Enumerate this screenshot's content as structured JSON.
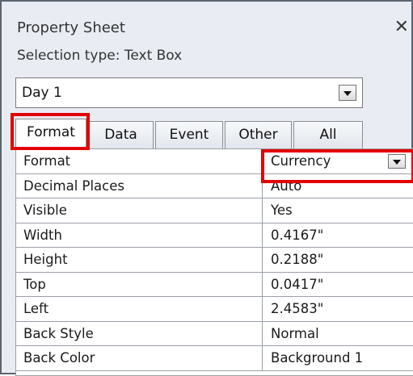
{
  "panel": {
    "title": "Property Sheet",
    "close_glyph": "✕",
    "selection_type": "Selection type:  Text Box"
  },
  "object_combo": {
    "value": "Day 1"
  },
  "tabs": [
    {
      "label": "Format",
      "active": true
    },
    {
      "label": "Data",
      "active": false
    },
    {
      "label": "Event",
      "active": false
    },
    {
      "label": "Other",
      "active": false
    },
    {
      "label": "All",
      "active": false
    }
  ],
  "properties": [
    {
      "name": "Format",
      "value": "Currency",
      "has_dropdown": true
    },
    {
      "name": "Decimal Places",
      "value": "Auto"
    },
    {
      "name": "Visible",
      "value": "Yes"
    },
    {
      "name": "Width",
      "value": "0.4167\""
    },
    {
      "name": "Height",
      "value": "0.2188\""
    },
    {
      "name": "Top",
      "value": "0.0417\""
    },
    {
      "name": "Left",
      "value": "2.4583\""
    },
    {
      "name": "Back Style",
      "value": "Normal"
    },
    {
      "name": "Back Color",
      "value": "Background 1"
    }
  ],
  "colors": {
    "highlight": "#e30000",
    "panel_bg": "#e9edf3"
  }
}
